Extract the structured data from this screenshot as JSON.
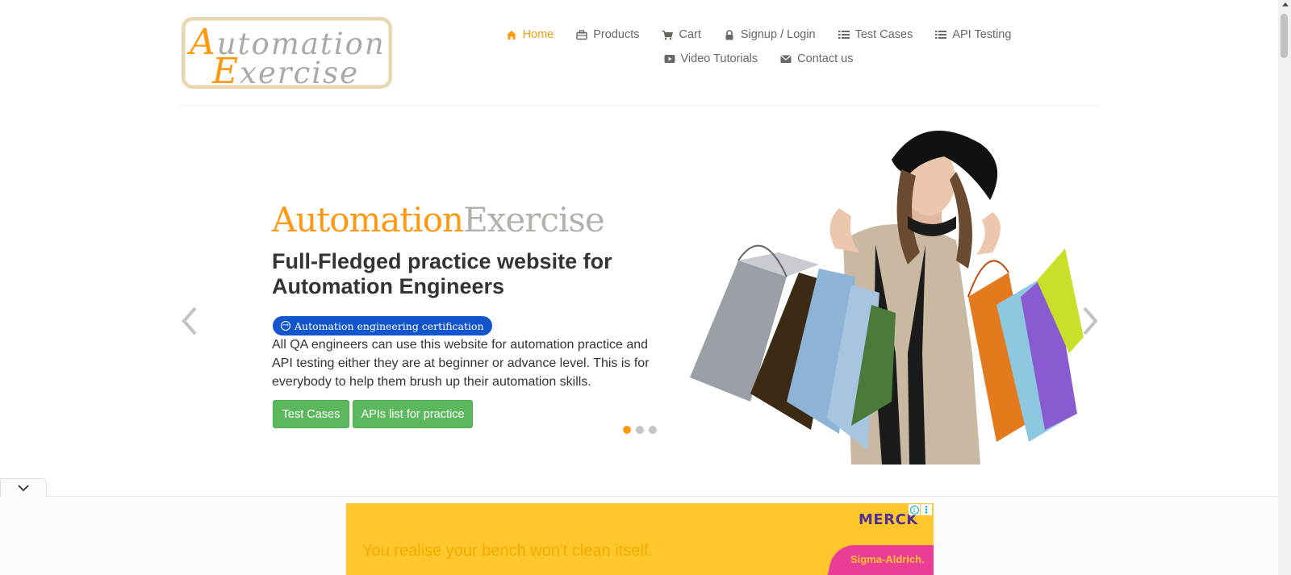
{
  "header": {
    "logo": {
      "line1_cap": "A",
      "line1_rest": "utomation",
      "line2_cap": "E",
      "line2_rest": "xercise"
    },
    "nav_row1": [
      {
        "label": "Home",
        "icon": "home-icon",
        "active": true
      },
      {
        "label": "Products",
        "icon": "products-icon",
        "active": false
      },
      {
        "label": "Cart",
        "icon": "cart-icon",
        "active": false
      },
      {
        "label": "Signup / Login",
        "icon": "lock-icon",
        "active": false
      },
      {
        "label": "Test Cases",
        "icon": "list-icon",
        "active": false
      },
      {
        "label": "API Testing",
        "icon": "list-icon",
        "active": false
      }
    ],
    "nav_row2": [
      {
        "label": "Video Tutorials",
        "icon": "youtube-play-icon",
        "active": false
      },
      {
        "label": "Contact us",
        "icon": "envelope-icon",
        "active": false
      }
    ]
  },
  "slider": {
    "title_part1": "Automation",
    "title_part2": "Exercise",
    "subtitle": "Full-Fledged practice website for Automation Engineers",
    "cert_badge": "Automation engineering certification",
    "description": "All QA engineers can use this website for automation practice and API testing either they are at beginner or advance level. This is for everybody to help them brush up their automation skills.",
    "button_test_cases": "Test Cases",
    "button_apis": "APIs list for practice",
    "dots": 3,
    "active_dot": 0
  },
  "ad": {
    "text": "You realise your bench won't clean itself.",
    "brand": "MERCK",
    "tagline": "Sigma-Aldrich."
  },
  "colors": {
    "accent": "#fe980f",
    "grey_text": "#b4b1ab",
    "button_green": "#5cb85c",
    "badge_blue": "#1255cc"
  }
}
